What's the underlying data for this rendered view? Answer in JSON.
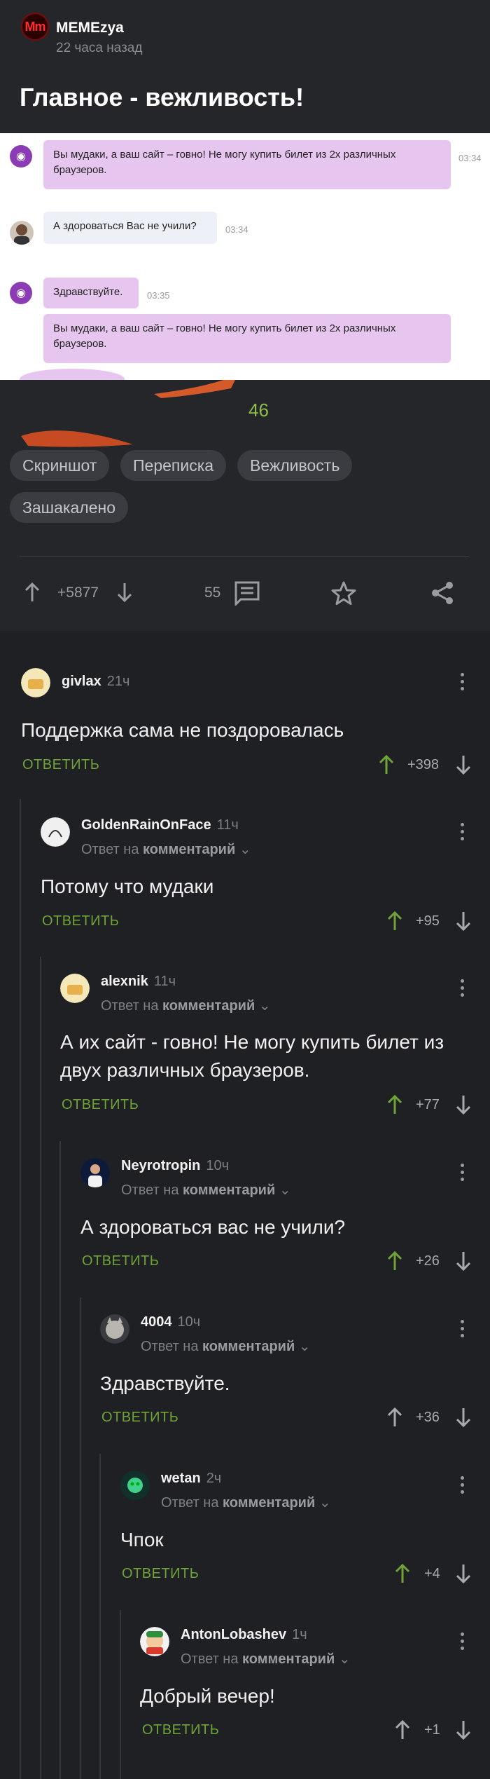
{
  "post": {
    "author": "MEMEzya",
    "avatar_text": "Mm",
    "time": "22 часа назад",
    "title": "Главное - вежливость!",
    "chat": {
      "messages": [
        {
          "text_line1": "Вы мудаки, а ваш сайт – говно! Не могу купить билет из 2х различных",
          "text_line2": "браузеров.",
          "time": "03:34"
        },
        {
          "text": "А здороваться Вас не учили?",
          "time": "03:34"
        },
        {
          "text": "Здравствуйте.",
          "time": "03:35"
        },
        {
          "text_line1": "Вы мудаки, а ваш сайт – говно! Не могу купить билет из 2х различных",
          "text_line2": "браузеров."
        }
      ]
    },
    "comments_count_overlay": "46",
    "tags": [
      "Скриншот",
      "Переписка",
      "Вежливость",
      "Зашакалено"
    ],
    "actions": {
      "rating": "+5877",
      "comments": "55"
    }
  },
  "colors": {
    "accent_green": "#6fa338",
    "background": "#1f2023",
    "chat_bubble": "#e6c6ee"
  },
  "comments": [
    {
      "user": "givlax",
      "time": "21ч",
      "text": "Поддержка сама не поздоровалась",
      "reply_label": "ОТВЕТИТЬ",
      "score": "+398"
    },
    {
      "user": "GoldenRainOnFace",
      "time": "11ч",
      "reply_to_prefix": "Ответ на",
      "reply_to": "комментарий",
      "text": "Потому что мудаки",
      "reply_label": "ОТВЕТИТЬ",
      "score": "+95"
    },
    {
      "user": "alexnik",
      "time": "11ч",
      "reply_to_prefix": "Ответ на",
      "reply_to": "комментарий",
      "text_line1": "А их сайт - говно! Не могу купить билет из",
      "text_line2": "двух различных браузеров.",
      "reply_label": "ОТВЕТИТЬ",
      "score": "+77"
    },
    {
      "user": "Neyrotropin",
      "time": "10ч",
      "reply_to_prefix": "Ответ на",
      "reply_to": "комментарий",
      "text": "А здороваться вас не учили?",
      "reply_label": "ОТВЕТИТЬ",
      "score": "+26"
    },
    {
      "user": "4004",
      "time": "10ч",
      "reply_to_prefix": "Ответ на",
      "reply_to": "комментарий",
      "text": "Здравствуйте.",
      "reply_label": "ОТВЕТИТЬ",
      "score": "+36"
    },
    {
      "user": "wetan",
      "time": "2ч",
      "reply_to_prefix": "Ответ на",
      "reply_to": "комментарий",
      "text": "Чпок",
      "reply_label": "ОТВЕТИТЬ",
      "score": "+4"
    },
    {
      "user": "AntonLobashev",
      "time": "1ч",
      "reply_to_prefix": "Ответ на",
      "reply_to": "комментарий",
      "text": "Добрый вечер!",
      "reply_label": "ОТВЕТИТЬ",
      "score": "+1"
    }
  ]
}
